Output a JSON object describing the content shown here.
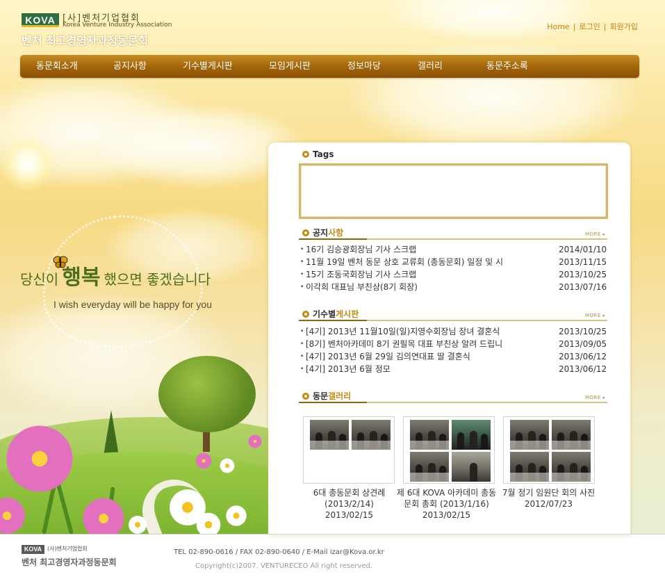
{
  "header": {
    "logo_mark": "KOVA",
    "assoc_kr": "[사]벤처기업협회",
    "assoc_en": "Korea Venture Industry Association",
    "site_title": "벤처 최고경영자과정동문회",
    "links": {
      "home": "Home",
      "login": "로그인",
      "join": "회원가입",
      "sep": "|"
    }
  },
  "nav": {
    "items": [
      "동문회소개",
      "공지사항",
      "기수별게시판",
      "모임게시판",
      "정보마당",
      "갤러리",
      "동문주소록"
    ]
  },
  "slogan": {
    "kr_part1": "당신이",
    "kr_part2": "행복",
    "kr_part3": "했으면 좋겠습니다",
    "en": "I wish everyday will be happy for you"
  },
  "tags": {
    "title": "Tags"
  },
  "notice": {
    "title_a": "공지",
    "title_b": "사항",
    "more": "MORE ▸",
    "rows": [
      {
        "title": "16기 김승광회장님 기사 스크랩",
        "date": "2014/01/10"
      },
      {
        "title": "11월 19일 벤처 동문 상호 교류회 (총동문회) 일정 및 시",
        "date": "2013/11/15"
      },
      {
        "title": "15기 조동국회장님 기사 스크랩",
        "date": "2013/10/25"
      },
      {
        "title": "이각희 대표님 부친상(8기 회장)",
        "date": "2013/07/16"
      }
    ]
  },
  "board": {
    "title_a": "기수별",
    "title_b": "게시판",
    "more": "MORE ▸",
    "rows": [
      {
        "title": "[4기] 2013년 11월10일(일)지영수회장님 장녀 결혼식",
        "date": "2013/10/25"
      },
      {
        "title": "[8기] 벤처아카데미 8기 권필목 대표 부친상 알려 드립니",
        "date": "2013/09/05"
      },
      {
        "title": "[4기] 2013년 6월 29일 김의연대표 딸 결혼식",
        "date": "2013/06/12"
      },
      {
        "title": "[4기] 2013년 6월 정모",
        "date": "2013/06/12"
      }
    ]
  },
  "gallery": {
    "title_a": "동문",
    "title_b": "갤러리",
    "more": "MORE ▸",
    "items": [
      {
        "caption": "6대 총동문회 상견례 (2013/2/14)",
        "date": "2013/02/15"
      },
      {
        "caption": "제 6대 KOVA 아카데미 총동문회 총회 (2013/1/16)",
        "date": "2013/02/15"
      },
      {
        "caption": "7월 정기 임원단 회의 사진",
        "date": "2012/07/23"
      }
    ]
  },
  "footer": {
    "logo_mark": "KOVA",
    "assoc_kr": "(사)벤처기업협회",
    "site_title": "벤처 최고경영자과정동문회",
    "info": "TEL 02-890-0616 / FAX 02-890-0640 / E-Mail izar@Kova.or.kr",
    "copyright": "Copyright(c)2007. VENTURECEO All right reserved."
  }
}
